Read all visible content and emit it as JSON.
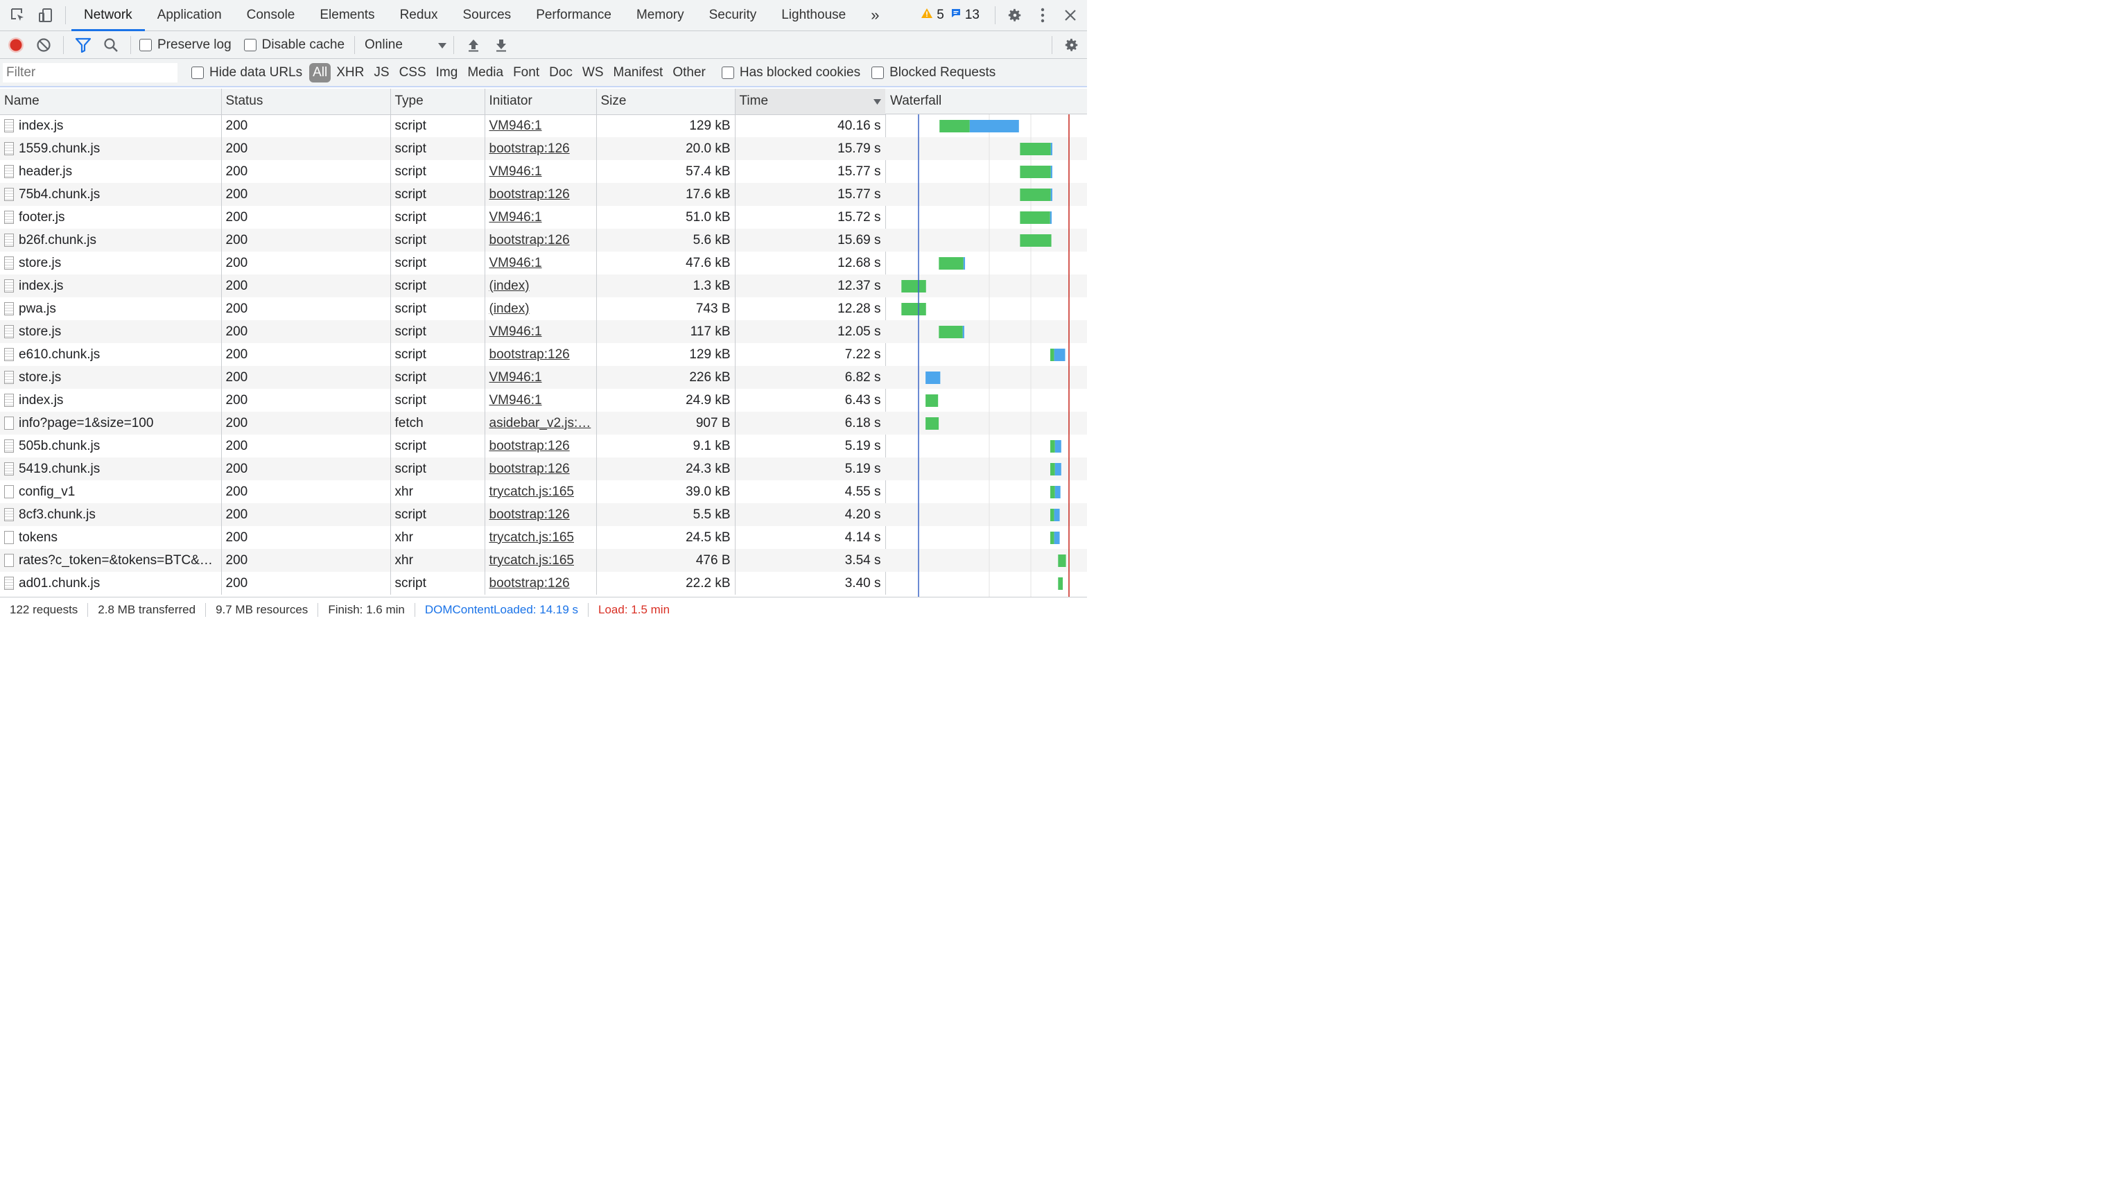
{
  "tabs": [
    "Network",
    "Application",
    "Console",
    "Elements",
    "Redux",
    "Sources",
    "Performance",
    "Memory",
    "Security",
    "Lighthouse"
  ],
  "more_tabs": "»",
  "warnings_count": "5",
  "messages_count": "13",
  "toolbar": {
    "preserve_log": "Preserve log",
    "disable_cache": "Disable cache",
    "throttle": "Online"
  },
  "filter": {
    "placeholder": "Filter",
    "hide_data_urls": "Hide data URLs",
    "types": [
      "All",
      "XHR",
      "JS",
      "CSS",
      "Img",
      "Media",
      "Font",
      "Doc",
      "WS",
      "Manifest",
      "Other"
    ],
    "has_blocked_cookies": "Has blocked cookies",
    "blocked_requests": "Blocked Requests"
  },
  "columns": {
    "name": "Name",
    "status": "Status",
    "type": "Type",
    "initiator": "Initiator",
    "size": "Size",
    "time": "Time",
    "waterfall": "Waterfall"
  },
  "rows": [
    {
      "name": "index.js",
      "status": "200",
      "type": "script",
      "initiator": "VM946:1",
      "size": "129 kB",
      "time": "40.16 s",
      "icon": "script-file-icon",
      "wf_start": 0.293,
      "wf_green": 0.193,
      "wf_blue": 0.314
    },
    {
      "name": "1559.chunk.js",
      "status": "200",
      "type": "script",
      "initiator": "bootstrap:126",
      "size": "20.0 kB",
      "time": "15.79 s",
      "icon": "script-file-icon",
      "wf_start": 0.807,
      "wf_green": 0.196,
      "wf_blue": 0.01
    },
    {
      "name": "header.js",
      "status": "200",
      "type": "script",
      "initiator": "VM946:1",
      "size": "57.4 kB",
      "time": "15.77 s",
      "icon": "script-file-icon",
      "wf_start": 0.807,
      "wf_green": 0.196,
      "wf_blue": 0.01
    },
    {
      "name": "75b4.chunk.js",
      "status": "200",
      "type": "script",
      "initiator": "bootstrap:126",
      "size": "17.6 kB",
      "time": "15.77 s",
      "icon": "script-file-icon",
      "wf_start": 0.807,
      "wf_green": 0.196,
      "wf_blue": 0.01
    },
    {
      "name": "footer.js",
      "status": "200",
      "type": "script",
      "initiator": "VM946:1",
      "size": "51.0 kB",
      "time": "15.72 s",
      "icon": "script-file-icon",
      "wf_start": 0.807,
      "wf_green": 0.192,
      "wf_blue": 0.01
    },
    {
      "name": "b26f.chunk.js",
      "status": "200",
      "type": "script",
      "initiator": "bootstrap:126",
      "size": "5.6 kB",
      "time": "15.69 s",
      "icon": "script-file-icon",
      "wf_start": 0.807,
      "wf_green": 0.2,
      "wf_blue": 0
    },
    {
      "name": "store.js",
      "status": "200",
      "type": "script",
      "initiator": "VM946:1",
      "size": "47.6 kB",
      "time": "12.68 s",
      "icon": "script-file-icon",
      "wf_start": 0.289,
      "wf_green": 0.157,
      "wf_blue": 0.01
    },
    {
      "name": "index.js",
      "status": "200",
      "type": "script",
      "initiator": "(index)",
      "size": "1.3 kB",
      "time": "12.37 s",
      "icon": "script-file-icon",
      "wf_start": 0.05,
      "wf_green": 0.157,
      "wf_blue": 0
    },
    {
      "name": "pwa.js",
      "status": "200",
      "type": "script",
      "initiator": "(index)",
      "size": "743 B",
      "time": "12.28 s",
      "icon": "script-file-icon",
      "wf_start": 0.05,
      "wf_green": 0.157,
      "wf_blue": 0
    },
    {
      "name": "store.js",
      "status": "200",
      "type": "script",
      "initiator": "VM946:1",
      "size": "117 kB",
      "time": "12.05 s",
      "icon": "script-file-icon",
      "wf_start": 0.289,
      "wf_green": 0.152,
      "wf_blue": 0.01
    },
    {
      "name": "e610.chunk.js",
      "status": "200",
      "type": "script",
      "initiator": "bootstrap:126",
      "size": "129 kB",
      "time": "7.22 s",
      "icon": "script-file-icon",
      "wf_start": 1.0,
      "wf_green": 0.025,
      "wf_blue": 0.07
    },
    {
      "name": "store.js",
      "status": "200",
      "type": "script",
      "initiator": "VM946:1",
      "size": "226 kB",
      "time": "6.82 s",
      "icon": "script-file-icon",
      "wf_start": 0.204,
      "wf_green": 0.0,
      "wf_blue": 0.094
    },
    {
      "name": "index.js",
      "status": "200",
      "type": "script",
      "initiator": "VM946:1",
      "size": "24.9 kB",
      "time": "6.43 s",
      "icon": "script-file-icon",
      "wf_start": 0.204,
      "wf_green": 0.08,
      "wf_blue": 0
    },
    {
      "name": "info?page=1&size=100",
      "status": "200",
      "type": "fetch",
      "initiator": "asidebar_v2.js:…",
      "size": "907 B",
      "time": "6.18 s",
      "icon": "blank-file-icon",
      "wf_start": 0.204,
      "wf_green": 0.084,
      "wf_blue": 0
    },
    {
      "name": "505b.chunk.js",
      "status": "200",
      "type": "script",
      "initiator": "bootstrap:126",
      "size": "9.1 kB",
      "time": "5.19 s",
      "icon": "script-file-icon",
      "wf_start": 1.0,
      "wf_green": 0.03,
      "wf_blue": 0.04
    },
    {
      "name": "5419.chunk.js",
      "status": "200",
      "type": "script",
      "initiator": "bootstrap:126",
      "size": "24.3 kB",
      "time": "5.19 s",
      "icon": "script-file-icon",
      "wf_start": 1.0,
      "wf_green": 0.03,
      "wf_blue": 0.04
    },
    {
      "name": "config_v1",
      "status": "200",
      "type": "xhr",
      "initiator": "trycatch.js:165",
      "size": "39.0 kB",
      "time": "4.55 s",
      "icon": "blank-file-icon",
      "wf_start": 1.0,
      "wf_green": 0.03,
      "wf_blue": 0.035
    },
    {
      "name": "8cf3.chunk.js",
      "status": "200",
      "type": "script",
      "initiator": "bootstrap:126",
      "size": "5.5 kB",
      "time": "4.20 s",
      "icon": "script-file-icon",
      "wf_start": 1.0,
      "wf_green": 0.025,
      "wf_blue": 0.035
    },
    {
      "name": "tokens",
      "status": "200",
      "type": "xhr",
      "initiator": "trycatch.js:165",
      "size": "24.5 kB",
      "time": "4.14 s",
      "icon": "blank-file-icon",
      "wf_start": 1.0,
      "wf_green": 0.025,
      "wf_blue": 0.035
    },
    {
      "name": "rates?c_token=&tokens=BTC&…",
      "status": "200",
      "type": "xhr",
      "initiator": "trycatch.js:165",
      "size": "476 B",
      "time": "3.54 s",
      "icon": "blank-file-icon",
      "wf_start": 1.05,
      "wf_green": 0.05,
      "wf_blue": 0
    },
    {
      "name": "ad01.chunk.js",
      "status": "200",
      "type": "script",
      "initiator": "bootstrap:126",
      "size": "22.2 kB",
      "time": "3.40 s",
      "icon": "script-file-icon",
      "wf_start": 1.05,
      "wf_green": 0.03,
      "wf_blue": 0
    }
  ],
  "status": {
    "requests": "122 requests",
    "transferred": "2.8 MB transferred",
    "resources": "9.7 MB resources",
    "finish": "Finish: 1.6 min",
    "dcl": "DOMContentLoaded: 14.19 s",
    "load": "Load: 1.5 min"
  },
  "colors": {
    "accent": "#1a73e8",
    "record": "#d93025",
    "waterfall_green": "#4dc45f",
    "waterfall_blue": "#4da6ec",
    "dcl_line": "#3c65c5",
    "load_line": "#c7271d"
  }
}
